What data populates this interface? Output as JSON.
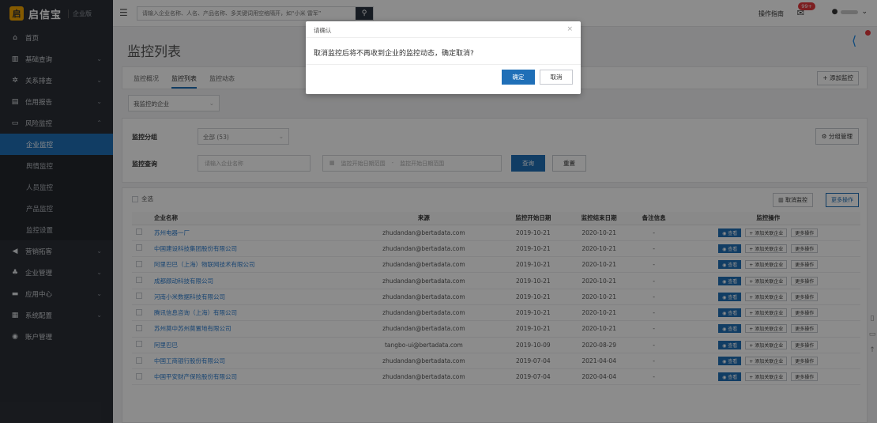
{
  "brand": {
    "logo_char": "启",
    "name": "启信宝",
    "edition": "企业版"
  },
  "sidebar": {
    "items": [
      {
        "icon": "home-icon",
        "glyph": "⌂",
        "label": "首页"
      },
      {
        "icon": "building-icon",
        "glyph": "▥",
        "label": "基础查询"
      },
      {
        "icon": "network-icon",
        "glyph": "✲",
        "label": "关系排查"
      },
      {
        "icon": "report-icon",
        "glyph": "▤",
        "label": "信用报告"
      },
      {
        "icon": "monitor-icon",
        "glyph": "▭",
        "label": "风险监控"
      }
    ],
    "sub_items": [
      "企业监控",
      "舆情监控",
      "人员监控",
      "产品监控",
      "监控设置"
    ],
    "bottom_items": [
      {
        "icon": "megaphone-icon",
        "glyph": "◀",
        "label": "营销拓客"
      },
      {
        "icon": "org-icon",
        "glyph": "♣",
        "label": "企业管理"
      },
      {
        "icon": "app-icon",
        "glyph": "▬",
        "label": "应用中心"
      },
      {
        "icon": "grid-icon",
        "glyph": "▦",
        "label": "系统配置"
      },
      {
        "icon": "account-icon",
        "glyph": "◉",
        "label": "账户管理"
      }
    ]
  },
  "topbar": {
    "search_placeholder": "请输入企业名称、人名、产品名称、多关键词用空格隔开，如“小米 雷军”",
    "guide": "操作指南",
    "badge": "99+"
  },
  "page": {
    "title": "监控列表",
    "tabs": [
      "监控概况",
      "监控列表",
      "监控动态"
    ],
    "add_button": "+ 添加监控",
    "filter_select": "我监控的企业",
    "group_label": "监控分组",
    "group_value": "全部 (53)",
    "group_manage": "分组管理",
    "query_label": "监控查询",
    "company_placeholder": "请输入企业名称",
    "date_start": "监控开始日期范围",
    "date_sep": "-",
    "date_end": "监控开始日期范围",
    "query_button": "查询",
    "reset_button": "重置",
    "select_all": "全选",
    "cancel_monitor": "取消监控",
    "more_ops": "更多操作"
  },
  "table": {
    "headers": [
      "企业名称",
      "来源",
      "监控开始日期",
      "监控结束日期",
      "备注信息",
      "监控操作"
    ],
    "op_view": "查看",
    "op_add": "+ 添加关联企业",
    "op_more": "更多操作",
    "rows": [
      {
        "name": "苏州电器一厂",
        "source": "zhudandan@bertadata.com",
        "start": "2019-10-21",
        "end": "2020-10-21",
        "note": "-"
      },
      {
        "name": "中国建设科技集团股份有限公司",
        "source": "zhudandan@bertadata.com",
        "start": "2019-10-21",
        "end": "2020-10-21",
        "note": "-"
      },
      {
        "name": "阿里巴巴（上海）物联网技术有限公司",
        "source": "zhudandan@bertadata.com",
        "start": "2019-10-21",
        "end": "2020-10-21",
        "note": "-"
      },
      {
        "name": "成都颇动科技有限公司",
        "source": "zhudandan@bertadata.com",
        "start": "2019-10-21",
        "end": "2020-10-21",
        "note": "-"
      },
      {
        "name": "河南小米数据科技有限公司",
        "source": "zhudandan@bertadata.com",
        "start": "2019-10-21",
        "end": "2020-10-21",
        "note": "-"
      },
      {
        "name": "腾讯信息咨询（上海）有限公司",
        "source": "zhudandan@bertadata.com",
        "start": "2019-10-21",
        "end": "2020-10-21",
        "note": "-"
      },
      {
        "name": "苏州莫中苏州莫置地有限公司",
        "source": "zhudandan@bertadata.com",
        "start": "2019-10-21",
        "end": "2020-10-21",
        "note": "-"
      },
      {
        "name": "阿里巴巴",
        "source": "tangbo-ui@bertadata.com",
        "start": "2019-10-09",
        "end": "2020-08-29",
        "note": "-"
      },
      {
        "name": "中国工商银行股份有限公司",
        "source": "zhudandan@bertadata.com",
        "start": "2019-07-04",
        "end": "2021-04-04",
        "note": "-"
      },
      {
        "name": "中国平安财产保险股份有限公司",
        "source": "zhudandan@bertadata.com",
        "start": "2019-07-04",
        "end": "2020-04-04",
        "note": "-"
      }
    ]
  },
  "dialog": {
    "title": "请确认",
    "close": "×",
    "message": "取消监控后将不再收到企业的监控动态，确定取消?",
    "confirm": "确定",
    "cancel": "取消"
  },
  "colors": {
    "primary": "#1f6fb7",
    "sidebar_bg": "#2b2f36",
    "link": "#2f7fd0",
    "badge": "#e4393c"
  }
}
